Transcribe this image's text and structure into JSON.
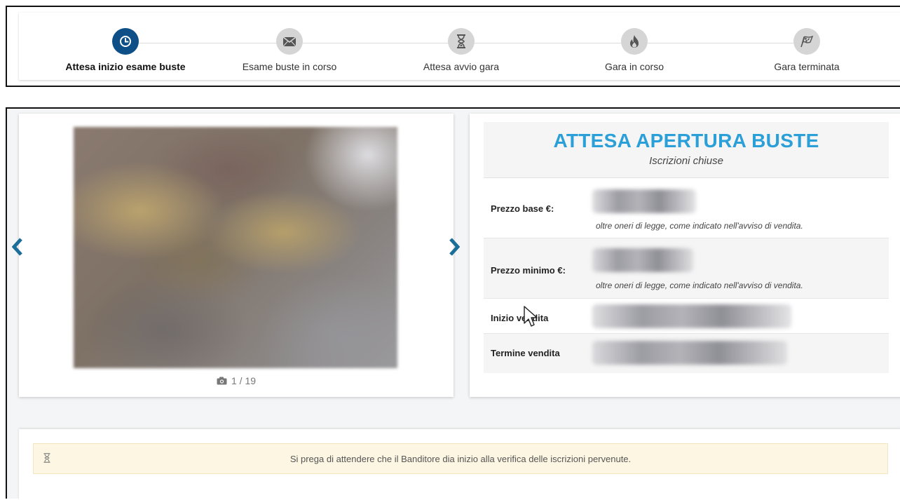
{
  "steps": [
    {
      "label": "Attesa inizio esame buste",
      "icon": "clock-icon",
      "active": true
    },
    {
      "label": "Esame buste in corso",
      "icon": "envelope-icon",
      "active": false
    },
    {
      "label": "Attesa avvio gara",
      "icon": "hourglass-icon",
      "active": false
    },
    {
      "label": "Gara in corso",
      "icon": "fire-icon",
      "active": false
    },
    {
      "label": "Gara terminata",
      "icon": "checkered-flag-icon",
      "active": false
    }
  ],
  "gallery": {
    "counter": "1 / 19"
  },
  "status": {
    "title": "ATTESA APERTURA BUSTE",
    "subtitle": "Iscrizioni chiuse"
  },
  "details": {
    "prezzo_base_label": "Prezzo base €:",
    "prezzo_base_note": "oltre oneri di legge, come indicato nell'avviso di vendita.",
    "prezzo_minimo_label": "Prezzo minimo €:",
    "prezzo_minimo_note": "oltre oneri di legge, come indicato nell'avviso di vendita.",
    "inizio_label": "Inizio vendita",
    "termine_label": "Termine vendita"
  },
  "notice": {
    "text": "Si prega di attendere che il Banditore dia inizio alla verifica delle iscrizioni pervenute."
  },
  "colors": {
    "active_step": "#0d4f86",
    "inactive_step": "#d5d5d5",
    "status_title": "#2b9fd8",
    "nav_arrow": "#1a6e97",
    "notice_bg": "#fcf6e3"
  }
}
